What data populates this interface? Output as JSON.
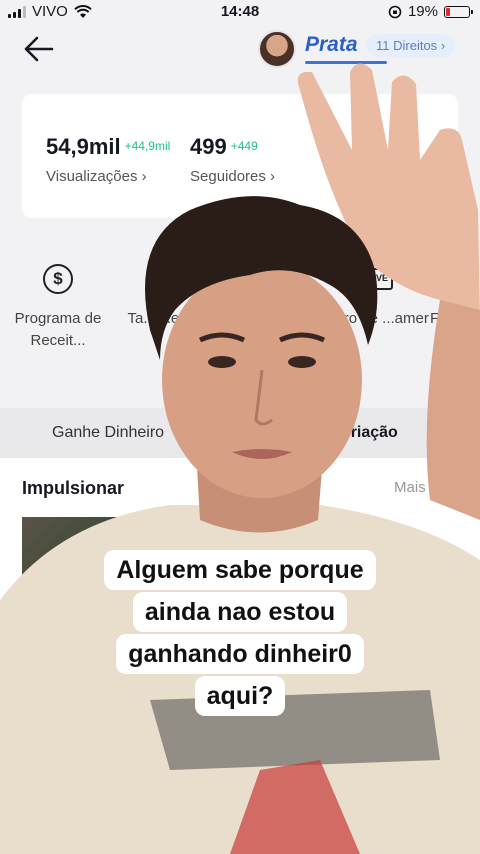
{
  "status_bar": {
    "carrier": "VIVO",
    "time": "14:48",
    "battery": "19%",
    "battery_level": 0.19
  },
  "header": {
    "tier": "Prata",
    "rights": "11 Direitos",
    "rights_chevron": "›"
  },
  "stats": [
    {
      "value": "54,9mil",
      "delta": "+44,9mil",
      "label": "Visualizações ›"
    },
    {
      "value": "499",
      "delta": "+449",
      "label": "Seguidores ›"
    }
  ],
  "tools": [
    {
      "label": "Programa de Receit...",
      "icon": "dollar-icon"
    },
    {
      "label": "Ta... Remu...",
      "icon": "gift-icon"
    },
    {
      "label": "...tro de ...amer",
      "icon": "live-icon",
      "icon_text": "LIVE"
    },
    {
      "label": "Fa...",
      "icon": "more-tool-icon"
    }
  ],
  "tabs": [
    {
      "label": "Ganhe Dinheiro"
    },
    {
      "label": "...rar Criação"
    }
  ],
  "section": {
    "title": "Impulsionar",
    "more": "Mais ›"
  },
  "caption": {
    "lines": [
      "Alguem sabe porque",
      "ainda nao estou",
      "ganhando dinheir0",
      "aqui?"
    ]
  },
  "colors": {
    "accent": "#fe2c55",
    "tier_blue": "#2a62c6",
    "delta_green": "#20c08a"
  }
}
